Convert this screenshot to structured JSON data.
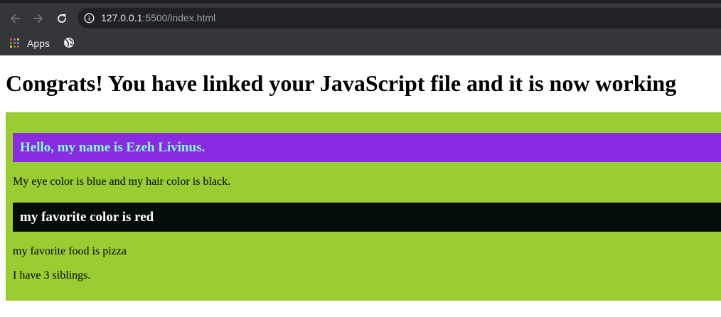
{
  "browser": {
    "url_host": "127.0.0.1",
    "url_path": ":5500/index.html",
    "bookmarks": {
      "apps_label": "Apps"
    }
  },
  "page": {
    "title": "Congrats! You have linked your JavaScript file and it is now working",
    "greeting": "Hello, my name is Ezeh Livinus.",
    "eye_hair": "My eye color is blue and my hair color is black.",
    "favorite_color": "my favorite color is red",
    "favorite_food": "my favorite food is pizza",
    "siblings": "I have 3 siblings."
  },
  "colors": {
    "panel_bg": "#9acd32",
    "greeting_bg": "#8a2be2",
    "greeting_text": "#7fffd4",
    "color_banner_bg": "#040d09",
    "color_banner_text": "#ffffff"
  },
  "icons": [
    "back-arrow-icon",
    "forward-arrow-icon",
    "reload-icon",
    "info-icon",
    "apps-grid-icon",
    "globe-icon"
  ]
}
